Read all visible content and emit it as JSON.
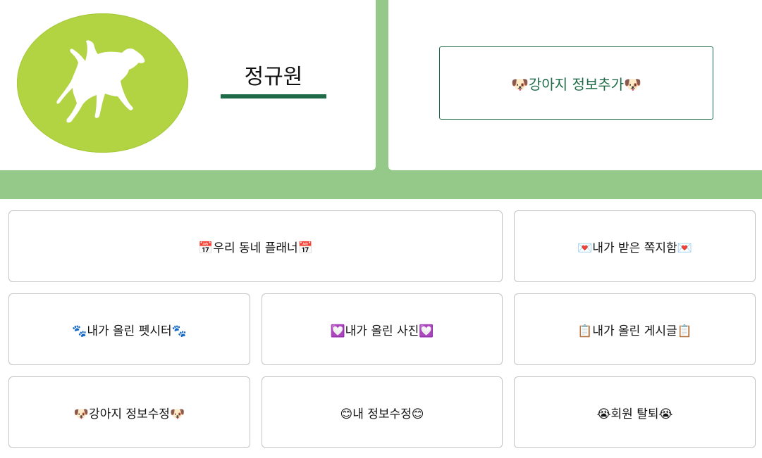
{
  "profile": {
    "username": "정규원"
  },
  "actions": {
    "add_dog": "🐶강아지 정보추가🐶"
  },
  "menu": {
    "planner": "📅우리 동네 플래너📅",
    "inbox": "💌내가 받은 쪽지함💌",
    "petsitter": "🐾내가 올린 펫시터🐾",
    "photos": "💟내가 올린 사진💟",
    "posts": "📋내가 올린 게시글📋",
    "dog_edit": "🐶강아지 정보수정🐶",
    "my_edit": "😊내 정보수정😊",
    "withdraw": "😭회원 탈퇴😭"
  },
  "colors": {
    "band": "#95c98a",
    "avatar": "#b2d443",
    "accent": "#1d6b47"
  },
  "icons": {
    "avatar": "dog-silhouette-icon"
  }
}
